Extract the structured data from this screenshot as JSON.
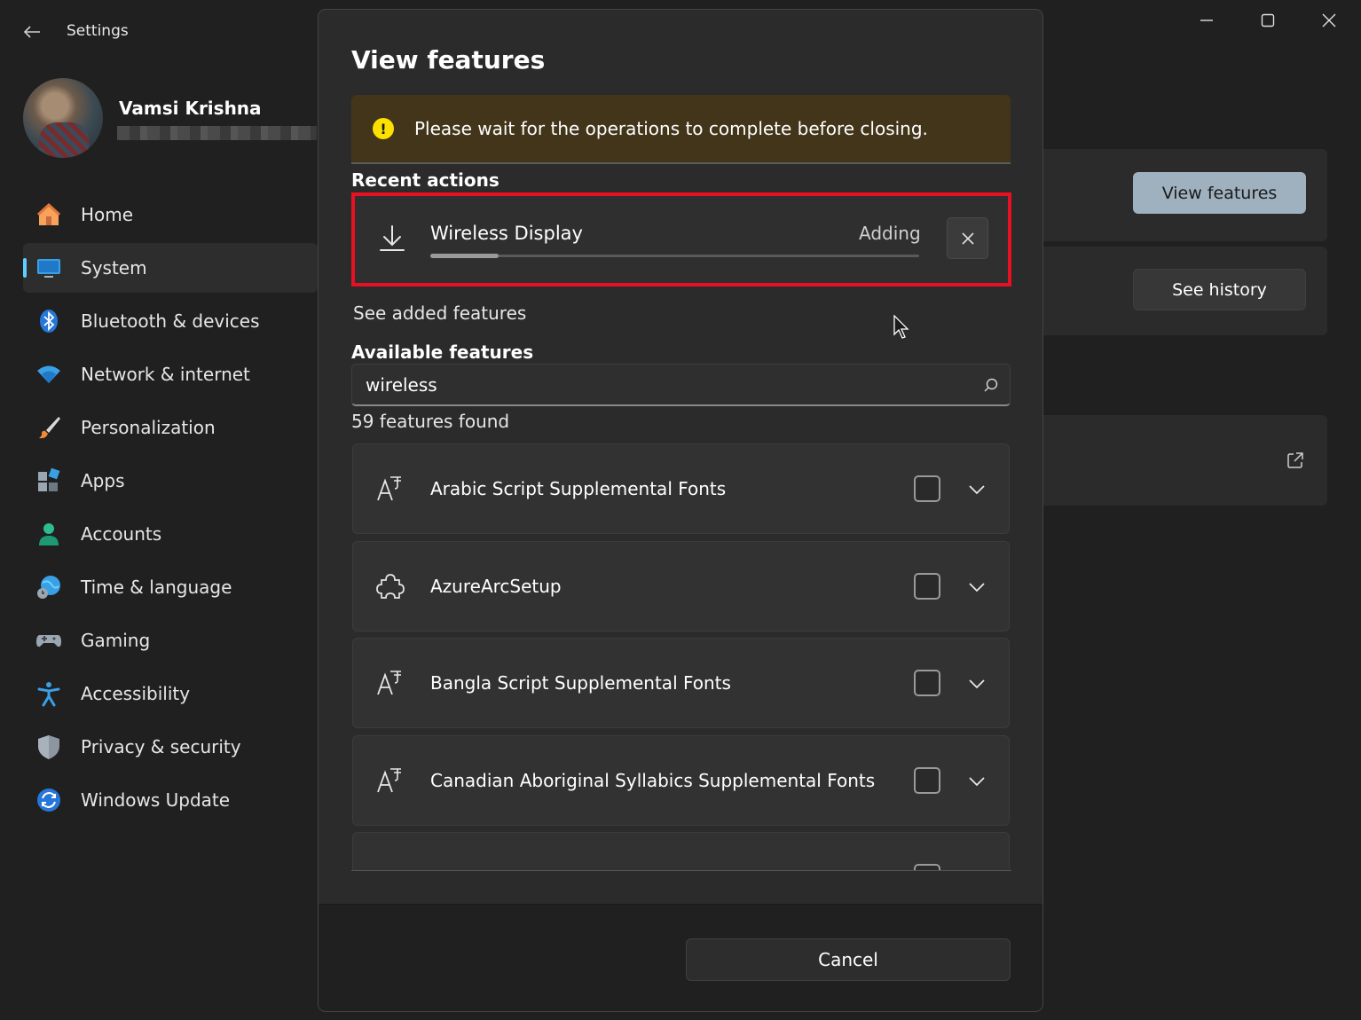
{
  "window": {
    "app_title": "Settings",
    "controls": [
      "minimize-icon",
      "maximize-icon",
      "close-icon"
    ]
  },
  "profile": {
    "name": "Vamsi Krishna"
  },
  "sidebar": {
    "items": [
      {
        "label": "Home",
        "icon": "home-icon",
        "selected": false
      },
      {
        "label": "System",
        "icon": "monitor-icon",
        "selected": true
      },
      {
        "label": "Bluetooth & devices",
        "icon": "bluetooth-icon",
        "selected": false
      },
      {
        "label": "Network & internet",
        "icon": "wifi-icon",
        "selected": false
      },
      {
        "label": "Personalization",
        "icon": "brush-icon",
        "selected": false
      },
      {
        "label": "Apps",
        "icon": "apps-icon",
        "selected": false
      },
      {
        "label": "Accounts",
        "icon": "person-icon",
        "selected": false
      },
      {
        "label": "Time & language",
        "icon": "globe-clock-icon",
        "selected": false
      },
      {
        "label": "Gaming",
        "icon": "gamepad-icon",
        "selected": false
      },
      {
        "label": "Accessibility",
        "icon": "accessibility-icon",
        "selected": false
      },
      {
        "label": "Privacy & security",
        "icon": "shield-icon",
        "selected": false
      },
      {
        "label": "Windows Update",
        "icon": "update-icon",
        "selected": false
      }
    ]
  },
  "background": {
    "view_features_label": "View features",
    "see_history_label": "See history"
  },
  "dialog": {
    "title": "View features",
    "warning": "Please wait for the operations to complete before closing.",
    "recent_actions_label": "Recent actions",
    "recent_action": {
      "name": "Wireless Display",
      "status": "Adding",
      "progress": 0.14
    },
    "see_added_label": "See added features",
    "available_label": "Available features",
    "search_value": "wireless",
    "count_text": "59 features found",
    "features": [
      {
        "name": "Arabic Script Supplemental Fonts",
        "icon": "font-icon"
      },
      {
        "name": "AzureArcSetup",
        "icon": "puzzle-icon"
      },
      {
        "name": "Bangla Script Supplemental Fonts",
        "icon": "font-icon"
      },
      {
        "name": "Canadian Aboriginal Syllabics Supplemental Fonts",
        "icon": "font-icon"
      }
    ],
    "cancel_label": "Cancel"
  },
  "colors": {
    "accent": "#60cdff",
    "highlight_border": "#e81123",
    "warning_bg": "#433519",
    "warning_icon": "#fce100"
  }
}
